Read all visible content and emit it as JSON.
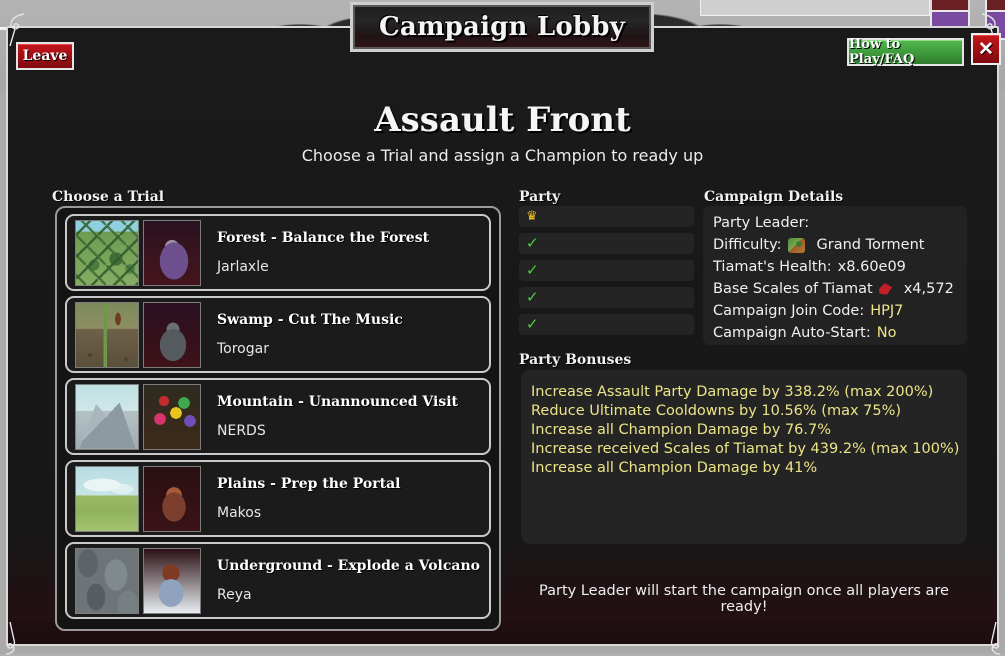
{
  "window": {
    "plaque_title": "Campaign Lobby",
    "leave_label": "Leave",
    "faq_label": "How to Play/FAQ",
    "close_label": "✕"
  },
  "header": {
    "title": "Assault Front",
    "subtitle": "Choose a Trial and assign a Champion to ready up"
  },
  "labels": {
    "trials": "Choose a Trial",
    "party": "Party",
    "details": "Campaign Details",
    "bonuses": "Party Bonuses"
  },
  "trials": [
    {
      "name": "Forest - Balance the Forest",
      "champion": "Jarlaxle",
      "scene_icon": "forest-thumbnail",
      "portrait_icon": "jarlaxle-portrait"
    },
    {
      "name": "Swamp - Cut The Music",
      "champion": "Torogar",
      "scene_icon": "swamp-thumbnail",
      "portrait_icon": "torogar-portrait"
    },
    {
      "name": "Mountain - Unannounced Visit",
      "champion": "NERDS",
      "scene_icon": "mountain-thumbnail",
      "portrait_icon": "nerds-portrait"
    },
    {
      "name": "Plains - Prep the Portal",
      "champion": "Makos",
      "scene_icon": "plains-thumbnail",
      "portrait_icon": "makos-portrait"
    },
    {
      "name": "Underground - Explode a Volcano",
      "champion": "Reya",
      "scene_icon": "underground-thumbnail",
      "portrait_icon": "reya-portrait"
    }
  ],
  "party_slots": [
    {
      "icon": "crown-icon",
      "glyph": "♛",
      "state": "leader"
    },
    {
      "icon": "check-icon",
      "glyph": "✓",
      "state": "ready"
    },
    {
      "icon": "check-icon",
      "glyph": "✓",
      "state": "ready"
    },
    {
      "icon": "check-icon",
      "glyph": "✓",
      "state": "ready"
    },
    {
      "icon": "check-icon",
      "glyph": "✓",
      "state": "ready"
    }
  ],
  "details": [
    {
      "label": "Party Leader:",
      "value": "",
      "icon": null,
      "accent": false
    },
    {
      "label": "Difficulty:",
      "value": "Grand Torment",
      "icon": "dragon-icon",
      "accent": false
    },
    {
      "label": "Tiamat's Health:",
      "value": "x8.60e09",
      "icon": null,
      "accent": false
    },
    {
      "label": "Base Scales of Tiamat",
      "value": "x4,572",
      "icon": "scale-icon",
      "accent": false
    },
    {
      "label": "Campaign Join Code:",
      "value": "HPJ7",
      "icon": null,
      "accent": true
    },
    {
      "label": "Campaign Auto-Start:",
      "value": "No",
      "icon": null,
      "accent": true
    }
  ],
  "bonuses": [
    "Increase Assault Party Damage by 338.2% (max 200%)",
    "Reduce Ultimate Cooldowns by 10.56% (max 75%)",
    "Increase all Champion Damage by 76.7%",
    "Increase received Scales of Tiamat by 439.2% (max 100%)",
    "Increase all Champion Damage by 41%"
  ],
  "footer_note": "Party Leader will start the campaign once all players are ready!",
  "colors": {
    "accent_yellow": "#ece487",
    "ready_green": "#49d13f",
    "crown_gold": "#f0c020",
    "danger_red": "#c5161c",
    "faq_green": "#52b84f",
    "panel_bg": "#242424",
    "window_bg": "#1a1a1a"
  }
}
